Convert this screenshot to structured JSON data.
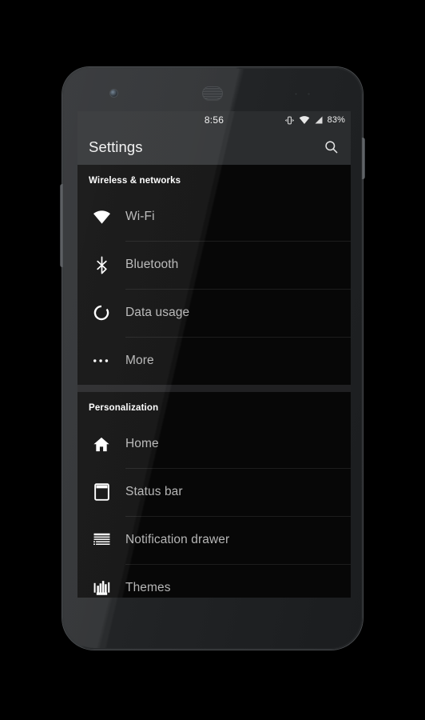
{
  "device": {
    "front_camera": "front-camera",
    "earpiece": "earpiece-speaker",
    "sensors": "proximity-sensor-dots",
    "power_button": "power-button",
    "volume_button": "volume-rocker"
  },
  "status_bar": {
    "clock": "8:56",
    "battery_percent": "83%",
    "icons": [
      "vibrate-icon",
      "wifi-signal-icon",
      "cell-signal-icon"
    ]
  },
  "action_bar": {
    "title": "Settings",
    "search_icon": "search-icon"
  },
  "sections": [
    {
      "header": "Wireless & networks",
      "items": [
        {
          "label": "Wi-Fi",
          "icon": "wifi-icon"
        },
        {
          "label": "Bluetooth",
          "icon": "bluetooth-icon"
        },
        {
          "label": "Data usage",
          "icon": "data-usage-icon"
        },
        {
          "label": "More",
          "icon": "more-dots-icon"
        }
      ]
    },
    {
      "header": "Personalization",
      "items": [
        {
          "label": "Home",
          "icon": "home-icon"
        },
        {
          "label": "Status bar",
          "icon": "status-bar-icon"
        },
        {
          "label": "Notification drawer",
          "icon": "notification-drawer-icon"
        },
        {
          "label": "Themes",
          "icon": "themes-icon"
        }
      ]
    }
  ],
  "colors": {
    "screen_background": "#000000",
    "bar_background": "#2b2d2f",
    "header_text": "#ffffff",
    "item_text": "#b6b6b6",
    "divider": "#1c1c1c",
    "section_gap": "#202022"
  }
}
